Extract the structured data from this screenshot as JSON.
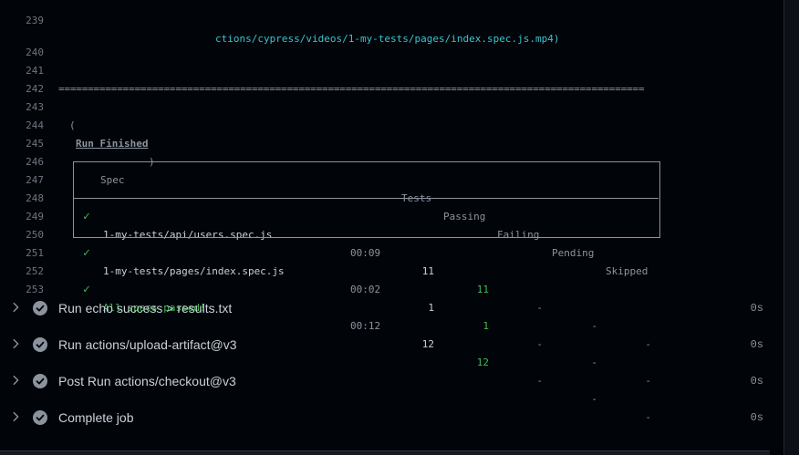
{
  "log": {
    "top_fragment": "ctions/cypress/videos/1-my-tests/pages/index.spec.js.mp4)",
    "separator": "====================================================================================================",
    "run_finished": {
      "open": "(",
      "label": "Run Finished",
      "close": ")"
    },
    "line_numbers": [
      "239",
      "240",
      "241",
      "242",
      "243",
      "244",
      "245",
      "246",
      "247",
      "248",
      "249",
      "250",
      "251",
      "252",
      "253"
    ],
    "headers": {
      "spec": "Spec",
      "tests": "Tests",
      "passing": "Passing",
      "failing": "Failing",
      "pending": "Pending",
      "skipped": "Skipped"
    },
    "rows": [
      {
        "check": "✓",
        "spec": "1-my-tests/api/users.spec.js",
        "time": "00:09",
        "tests": "11",
        "passing": "11",
        "failing": "-",
        "pending": "-",
        "skipped": "-"
      },
      {
        "check": "✓",
        "spec": "1-my-tests/pages/index.spec.js",
        "time": "00:02",
        "tests": "1",
        "passing": "1",
        "failing": "-",
        "pending": "-",
        "skipped": "-"
      }
    ],
    "summary": {
      "check": "✓",
      "label": "All specs passed!",
      "time": "00:12",
      "tests": "12",
      "passing": "12",
      "failing": "-",
      "pending": "-",
      "skipped": "-"
    }
  },
  "steps": [
    {
      "label": "Run echo success > results.txt",
      "time": "0s",
      "icon": "check-circle-icon"
    },
    {
      "label": "Run actions/upload-artifact@v3",
      "time": "0s",
      "icon": "check-circle-icon"
    },
    {
      "label": "Post Run actions/checkout@v3",
      "time": "0s",
      "icon": "check-circle-icon"
    },
    {
      "label": "Complete job",
      "time": "0s",
      "icon": "check-circle-icon"
    }
  ],
  "colors": {
    "background": "#010409",
    "success": "#3fb950",
    "muted": "#8b949e",
    "text": "#c9d1d9"
  }
}
